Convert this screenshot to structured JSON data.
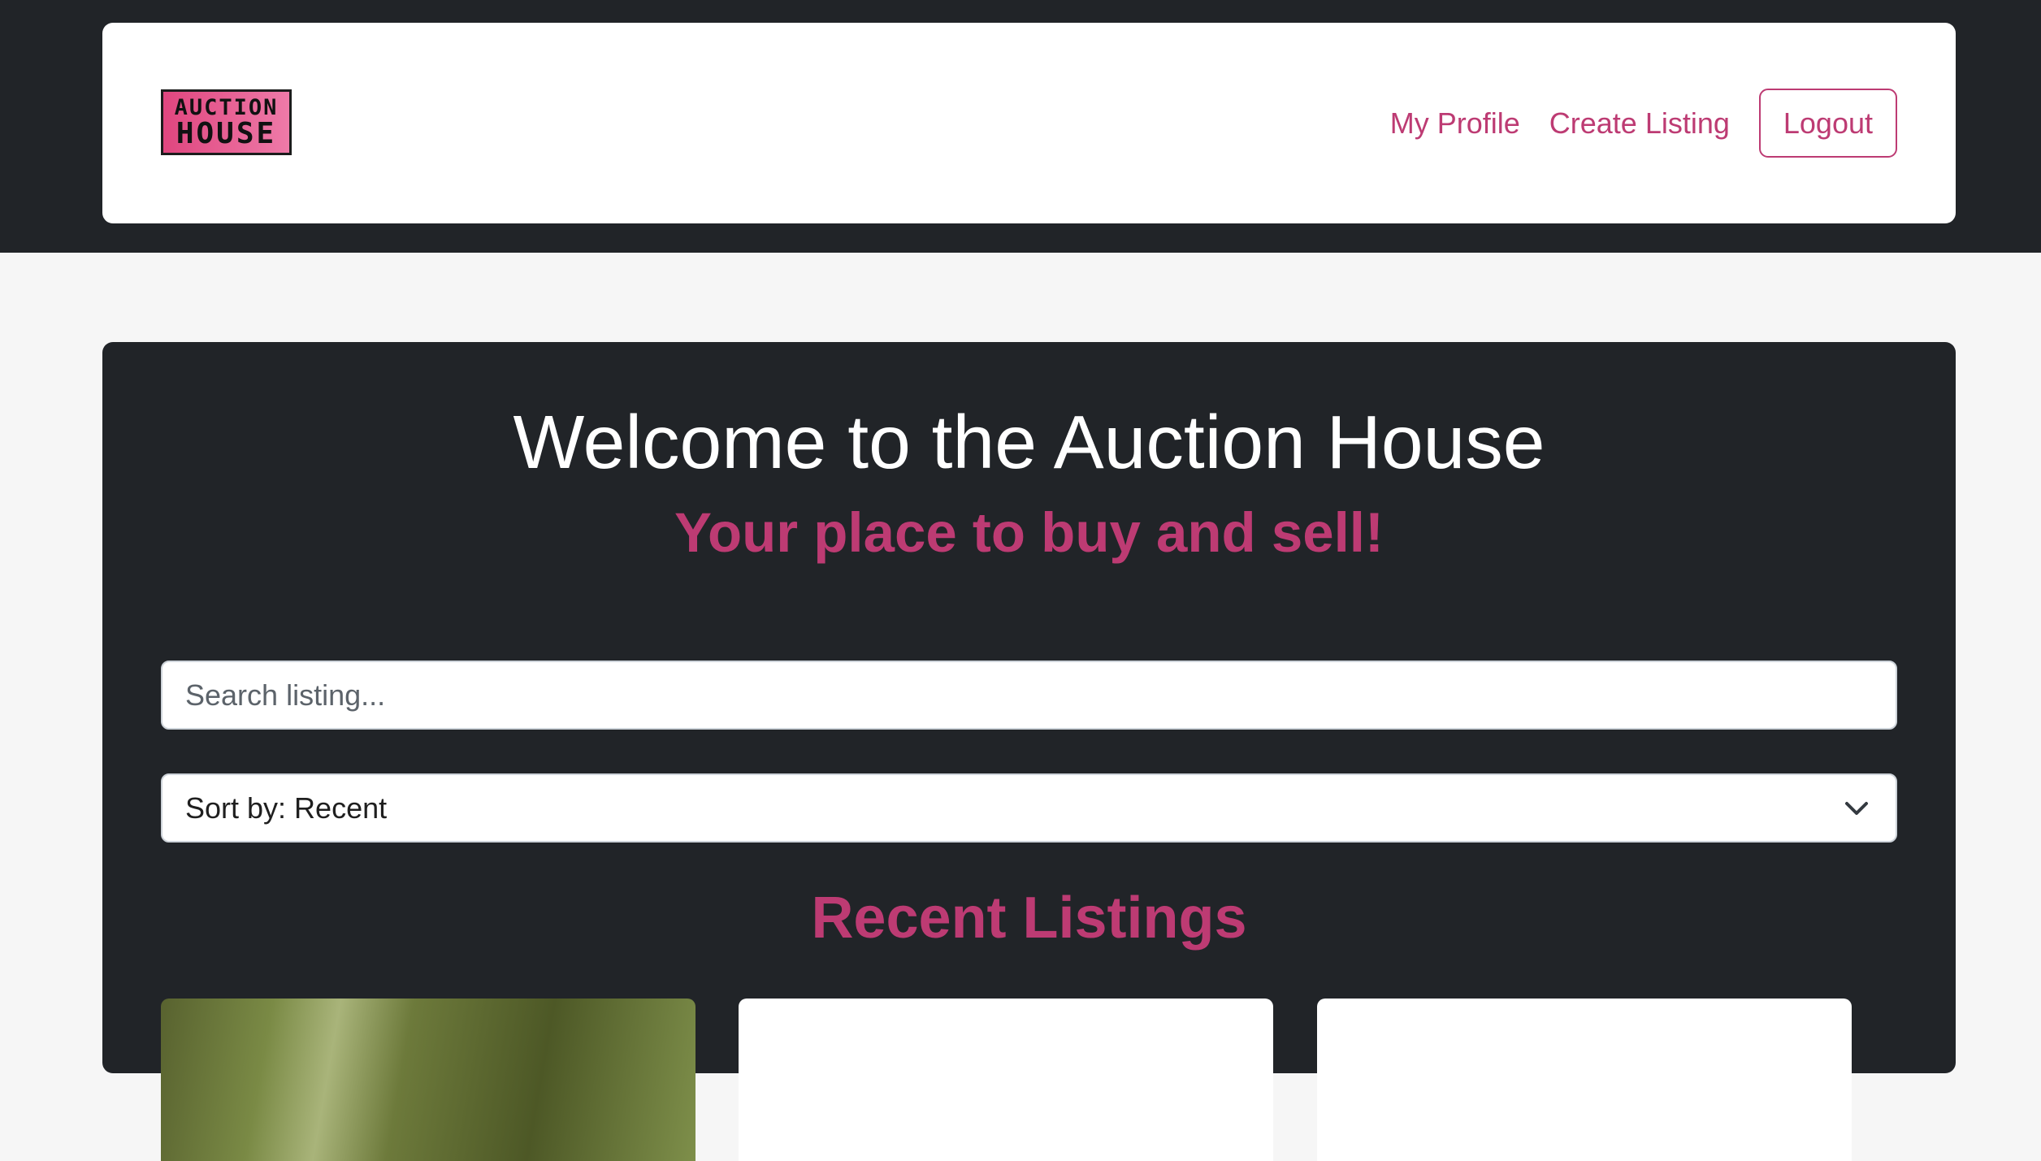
{
  "header": {
    "logo": {
      "line1": "AUCTION",
      "line2": "HOUSE"
    },
    "nav": {
      "profile_label": "My Profile",
      "create_label": "Create Listing",
      "logout_label": "Logout"
    }
  },
  "hero": {
    "title": "Welcome to the Auction House",
    "subtitle": "Your place to buy and sell!",
    "search": {
      "placeholder": "Search listing...",
      "value": ""
    },
    "sort": {
      "selected": "Sort by: Recent"
    },
    "recent_heading": "Recent Listings"
  },
  "listings": [
    {
      "image": "listing-image"
    },
    {
      "image": "listing-image"
    },
    {
      "image": "listing-image"
    }
  ],
  "colors": {
    "accent": "#bd3b73",
    "dark": "#212428",
    "page_bg": "#f6f6f6",
    "logo_pink": "#e0467f"
  },
  "icons": {
    "sort_chevron": "chevron-down-icon"
  }
}
